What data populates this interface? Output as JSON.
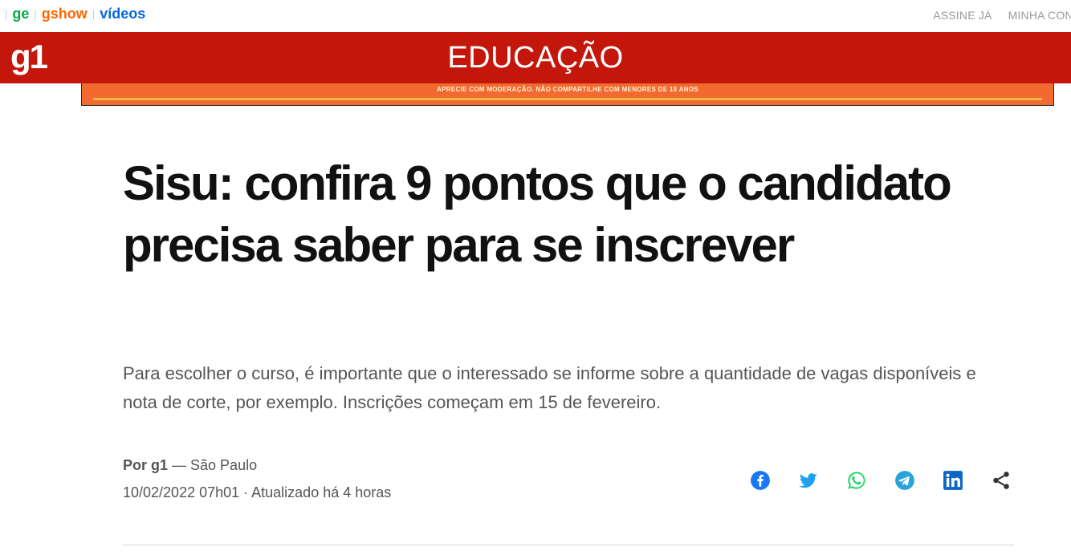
{
  "topbar": {
    "links": [
      "ge",
      "gshow",
      "vídeos"
    ],
    "right": [
      "ASSINE JÁ",
      "MINHA CONTA"
    ]
  },
  "header": {
    "logo": "g1",
    "section": "EDUCAÇÃO"
  },
  "ad": {
    "text": "APRECIE COM MODERAÇÃO. NÃO COMPARTILHE COM MENORES DE 18 ANOS"
  },
  "article": {
    "headline": "Sisu: confira 9 pontos que o candidato precisa saber para se inscrever",
    "subtitle": "Para escolher o curso, é importante que o interessado se informe sobre a quantidade de vagas disponíveis e nota de corte, por exemplo. Inscrições começam em 15 de fevereiro.",
    "byline_author": "Por g1",
    "byline_location": " — São Paulo",
    "date": "10/02/2022 07h01 · Atualizado há 4 horas"
  },
  "share_icons": [
    "facebook-icon",
    "twitter-icon",
    "whatsapp-icon",
    "telegram-icon",
    "linkedin-icon",
    "share-icon"
  ],
  "colors": {
    "header_red": "#c4170c",
    "ge_green": "#06aa48",
    "gshow_orange": "#ff6600",
    "videos_blue": "#0669de"
  }
}
